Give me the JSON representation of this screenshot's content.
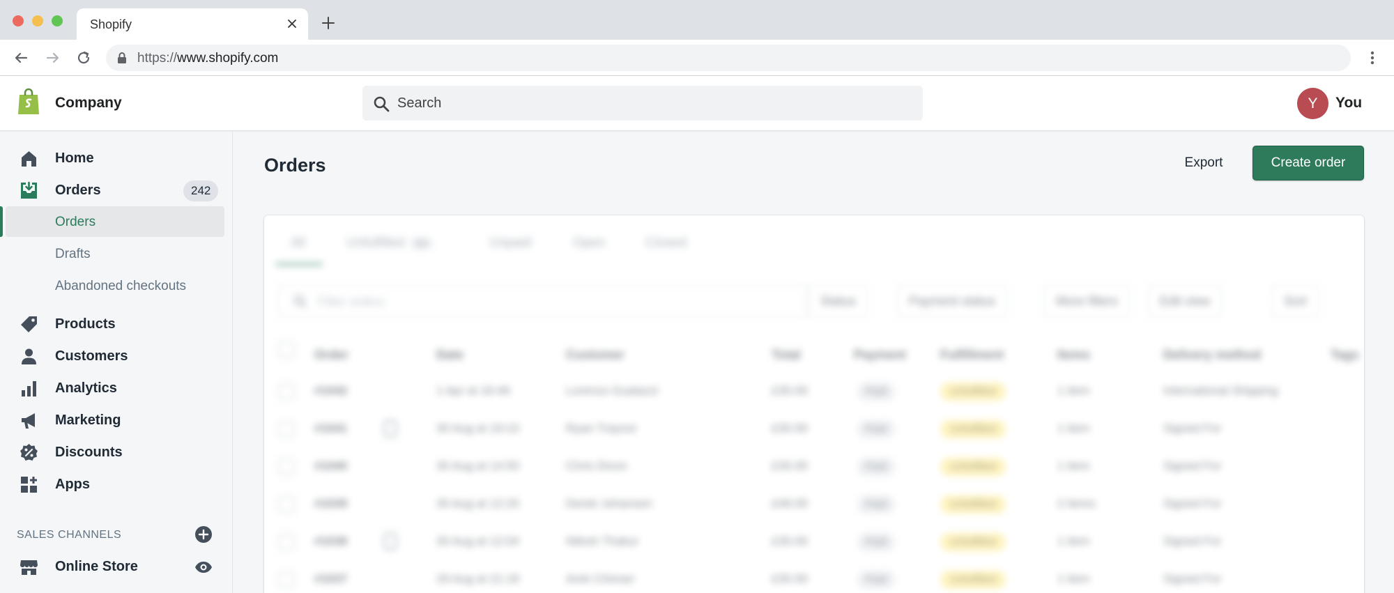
{
  "browser": {
    "tab_title": "Shopify",
    "url_scheme": "https://",
    "url_host": "www.shopify.com"
  },
  "topbar": {
    "store_name": "Company",
    "search_placeholder": "Search",
    "avatar_initial": "Y",
    "user_name": "You"
  },
  "sidebar": {
    "home": "Home",
    "orders": "Orders",
    "orders_count": "242",
    "sub_orders": "Orders",
    "sub_drafts": "Drafts",
    "sub_abandoned": "Abandoned checkouts",
    "products": "Products",
    "customers": "Customers",
    "analytics": "Analytics",
    "marketing": "Marketing",
    "discounts": "Discounts",
    "apps": "Apps",
    "sales_channels_title": "SALES CHANNELS",
    "online_store": "Online Store"
  },
  "main": {
    "title": "Orders",
    "export_label": "Export",
    "create_label": "Create order"
  },
  "orders_card": {
    "tabs": [
      "All",
      "Unfulfilled",
      "Unpaid",
      "Open",
      "Closed"
    ],
    "unfulfilled_count": "50",
    "filter_placeholder": "Filter orders",
    "filter_buttons": [
      "Status",
      "Payment status",
      "More filters",
      "Edit view",
      "Sort"
    ],
    "columns": [
      "Order",
      "Date",
      "Customer",
      "Total",
      "Payment",
      "Fulfillment",
      "Items",
      "Delivery method",
      "Tags"
    ],
    "rows": [
      {
        "order": "#1042",
        "date": "1 Apr at 16:46",
        "customer": "Lorenzo Gualazzi",
        "total": "£30.00",
        "payment": "Paid",
        "fulfillment": "Unfulfilled",
        "items": "1 item",
        "delivery": "International Shipping"
      },
      {
        "order": "#1041",
        "date": "30 Aug at 19:10",
        "customer": "Ryan Traynor",
        "total": "£30.00",
        "payment": "Paid",
        "fulfillment": "Unfulfilled",
        "items": "1 item",
        "delivery": "Signed For"
      },
      {
        "order": "#1040",
        "date": "30 Aug at 14:50",
        "customer": "Chris Dixon",
        "total": "£30.00",
        "payment": "Paid",
        "fulfillment": "Unfulfilled",
        "items": "1 item",
        "delivery": "Signed For"
      },
      {
        "order": "#1039",
        "date": "30 Aug at 12:20",
        "customer": "Derek Johansen",
        "total": "£48.00",
        "payment": "Paid",
        "fulfillment": "Unfulfilled",
        "items": "2 items",
        "delivery": "Signed For"
      },
      {
        "order": "#1038",
        "date": "30 Aug at 12:04",
        "customer": "Nilesh Thakur",
        "total": "£30.00",
        "payment": "Paid",
        "fulfillment": "Unfulfilled",
        "items": "1 item",
        "delivery": "Signed For"
      },
      {
        "order": "#1037",
        "date": "29 Aug at 21:18",
        "customer": "Arek Chiman",
        "total": "£30.00",
        "payment": "Paid",
        "fulfillment": "Unfulfilled",
        "items": "1 item",
        "delivery": "Signed For"
      }
    ]
  },
  "colors": {
    "brand_green": "#2d7b5a",
    "shopify_bag": "#95bf47",
    "avatar_bg": "#b84c52",
    "fulfillment_badge": "#ffea8a"
  }
}
